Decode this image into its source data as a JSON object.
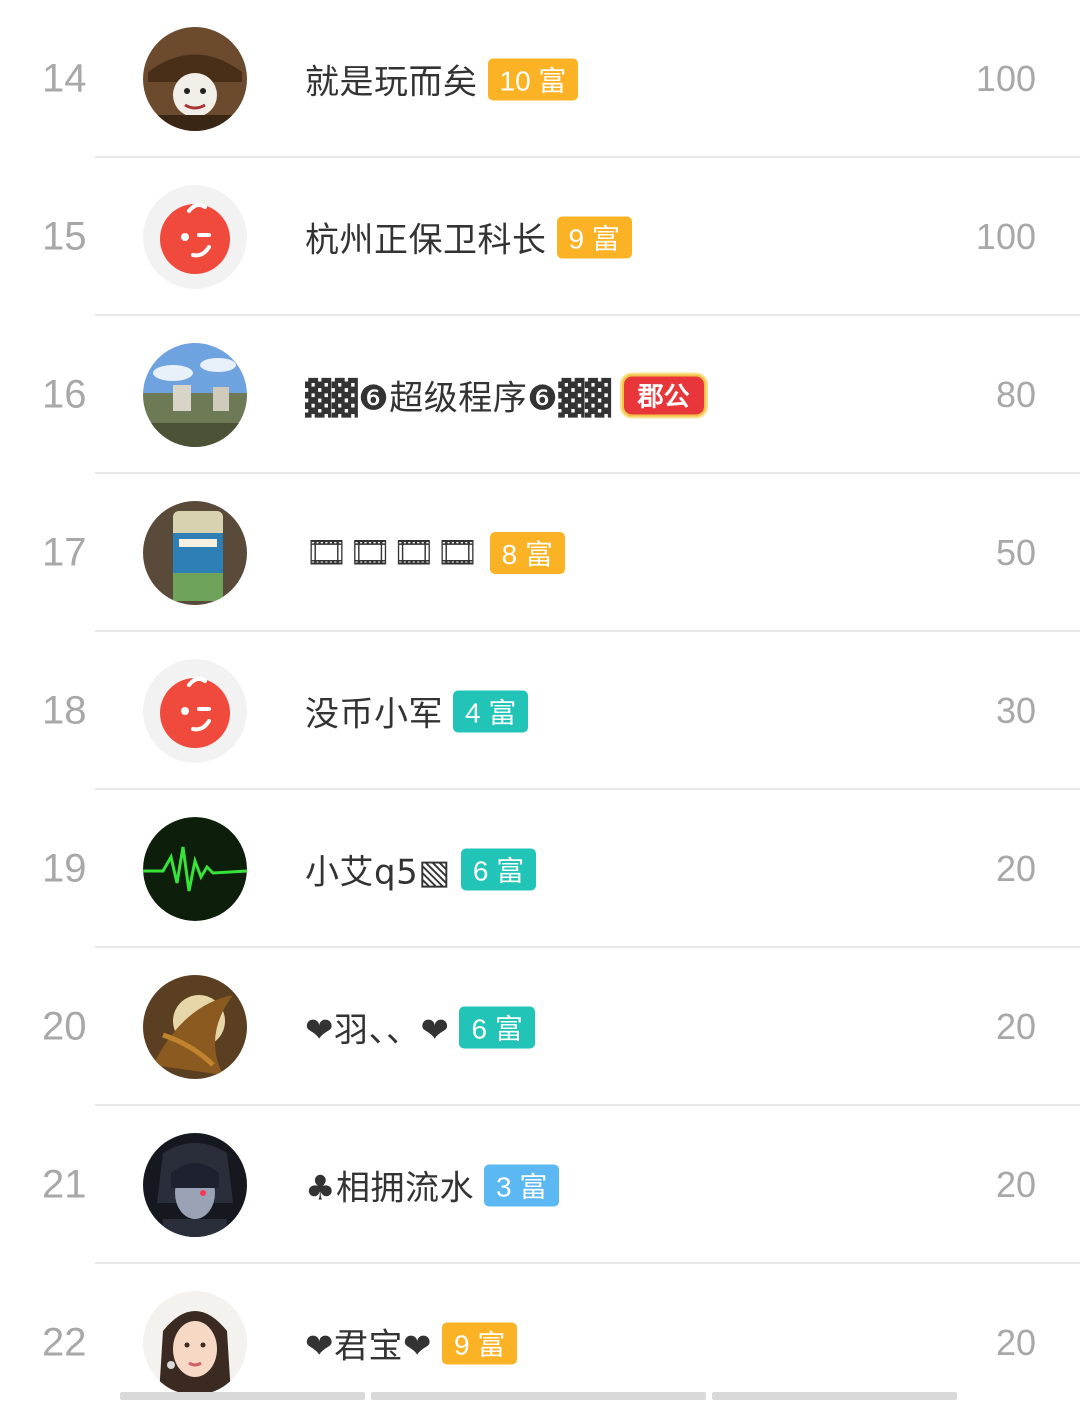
{
  "rows": [
    {
      "rank": "14",
      "name": "就是玩而矣",
      "badge": "10 富",
      "score": "100"
    },
    {
      "rank": "15",
      "name": "杭州正保卫科长",
      "badge": "9 富",
      "score": "100"
    },
    {
      "rank": "16",
      "name": "▓▓❻超级程序❻▓▓",
      "badge": "郡公",
      "score": "80"
    },
    {
      "rank": "17",
      "name": "🎞🎞🎞🎞",
      "badge": "8 富",
      "score": "50"
    },
    {
      "rank": "18",
      "name": "没币小军",
      "badge": "4 富",
      "score": "30"
    },
    {
      "rank": "19",
      "name": "小艾q5▧",
      "badge": "6 富",
      "score": "20"
    },
    {
      "rank": "20",
      "name": "❤羽、、❤",
      "badge": "6 富",
      "score": "20"
    },
    {
      "rank": "21",
      "name": "♣相拥流水",
      "badge": "3 富",
      "score": "20"
    },
    {
      "rank": "22",
      "name": "❤君宝❤",
      "badge": "9 富",
      "score": "20"
    }
  ],
  "colors": {
    "badge_orange": "#fbb225",
    "badge_teal": "#22c4b8",
    "badge_blue": "#5cb8f2",
    "badge_red": "#e8363b",
    "rank_gray": "#a8a8a8"
  },
  "icons": {
    "default_avatar": "red-wink-face-icon"
  }
}
